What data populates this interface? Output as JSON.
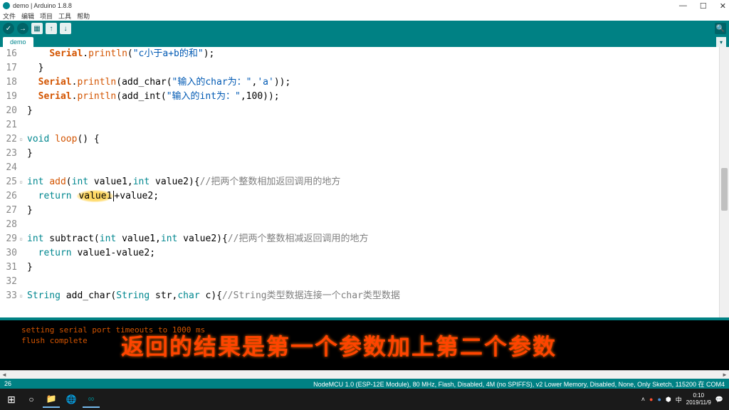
{
  "window": {
    "title": "demo | Arduino 1.8.8",
    "minimize": "—",
    "maximize": "☐",
    "close": "✕"
  },
  "menu": {
    "file": "文件",
    "edit": "编辑",
    "project": "项目",
    "tools": "工具",
    "help": "帮助"
  },
  "tab": {
    "name": "demo"
  },
  "code": {
    "lines": [
      {
        "n": "16",
        "html": "    <span class='k-cls'>Serial</span>.<span class='k-func'>println</span>(<span class='k-str'>\"c小于a+b的和\"</span>);"
      },
      {
        "n": "17",
        "html": "  }"
      },
      {
        "n": "18",
        "html": "  <span class='k-cls'>Serial</span>.<span class='k-func'>println</span>(add_char(<span class='k-str'>\"输入的char为：\"</span>,<span class='k-str'>'a'</span>));"
      },
      {
        "n": "19",
        "html": "  <span class='k-cls'>Serial</span>.<span class='k-func'>println</span>(add_int(<span class='k-str'>\"输入的int为：\"</span>,100));"
      },
      {
        "n": "20",
        "html": "}"
      },
      {
        "n": "21",
        "html": ""
      },
      {
        "n": "22",
        "fold": true,
        "html": "<span class='k-type'>void</span> <span class='k-func'>loop</span>() {"
      },
      {
        "n": "23",
        "html": "}"
      },
      {
        "n": "24",
        "html": ""
      },
      {
        "n": "25",
        "fold": true,
        "html": "<span class='k-type'>int</span> <span class='k-func'>add</span>(<span class='k-type'>int</span> value1,<span class='k-type'>int</span> value2){<span class='k-comment'>//把两个整数相加返回调用的地方</span>"
      },
      {
        "n": "26",
        "html": "  <span class='k-kw'>return</span> <span class='highlight'>value1</span><span class='cursor-mark'></span>+value2;"
      },
      {
        "n": "27",
        "html": "}"
      },
      {
        "n": "28",
        "html": ""
      },
      {
        "n": "29",
        "fold": true,
        "html": "<span class='k-type'>int</span> subtract(<span class='k-type'>int</span> value1,<span class='k-type'>int</span> value2){<span class='k-comment'>//把两个整数相减返回调用的地方</span>"
      },
      {
        "n": "30",
        "html": "  <span class='k-kw'>return</span> value1-value2;"
      },
      {
        "n": "31",
        "html": "}"
      },
      {
        "n": "32",
        "html": ""
      },
      {
        "n": "33",
        "fold": true,
        "html": "<span class='k-type'>String</span> add_char(<span class='k-type'>String</span> str,<span class='k-type'>char</span> c){<span class='k-comment'>//String类型数据连接一个char类型数据</span>"
      }
    ]
  },
  "console": {
    "line1": "setting serial port timeouts to 1000 ms",
    "line2": "flush complete"
  },
  "annotation": "返回的结果是第一个参数加上第二个参数",
  "status": {
    "left": "26",
    "right": "NodeMCU 1.0 (ESP-12E Module), 80 MHz, Flash, Disabled, 4M (no SPIFFS), v2 Lower Memory, Disabled, None, Only Sketch, 115200 在 COM4"
  },
  "tray": {
    "ime": "中",
    "time": "0:10",
    "date": "2019/11/9"
  }
}
